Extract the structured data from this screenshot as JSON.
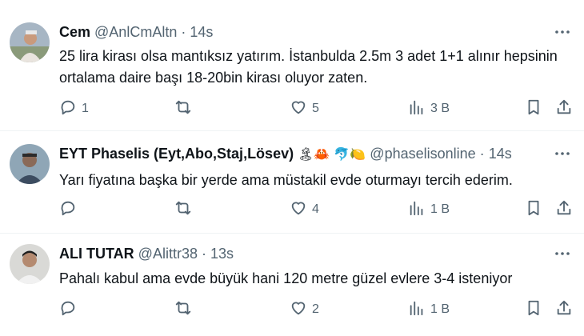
{
  "tweets": [
    {
      "name": "Cem",
      "handle": "@AnlCmAltn",
      "separator": "·",
      "time": "14s",
      "emoji": "",
      "text": "25 lira kirası olsa mantıksız yatırım. İstanbulda 2.5m 3 adet 1+1 alınır hepsinin ortalama daire başı 18-20bin kirası oluyor zaten.",
      "replies": "1",
      "retweets": "",
      "likes": "5",
      "views": "3 B"
    },
    {
      "name": "EYT Phaselis (Eyt,Abo,Staj,Lösev)",
      "handle": "@phaselisonline",
      "separator": "·",
      "time": "14s",
      "emoji": "🏝🦀 🐬🍋",
      "text": "Yarı fiyatına başka bir yerde ama müstakil evde oturmayı tercih ederim.",
      "replies": "",
      "retweets": "",
      "likes": "4",
      "views": "1 B"
    },
    {
      "name": "ALI TUTAR",
      "handle": "@Alittr38",
      "separator": "·",
      "time": "13s",
      "emoji": "",
      "text": "Pahalı kabul ama evde büyük hani 120 metre güzel evlere 3-4 isteniyor",
      "replies": "",
      "retweets": "",
      "likes": "2",
      "views": "1 B"
    }
  ],
  "icons": {
    "more": "more-icon",
    "reply": "reply-icon",
    "retweet": "retweet-icon",
    "like": "heart-icon",
    "views": "views-icon",
    "bookmark": "bookmark-icon",
    "share": "share-icon"
  },
  "colors": {
    "text": "#0f1419",
    "secondary": "#536471",
    "divider": "#eff3f4"
  }
}
